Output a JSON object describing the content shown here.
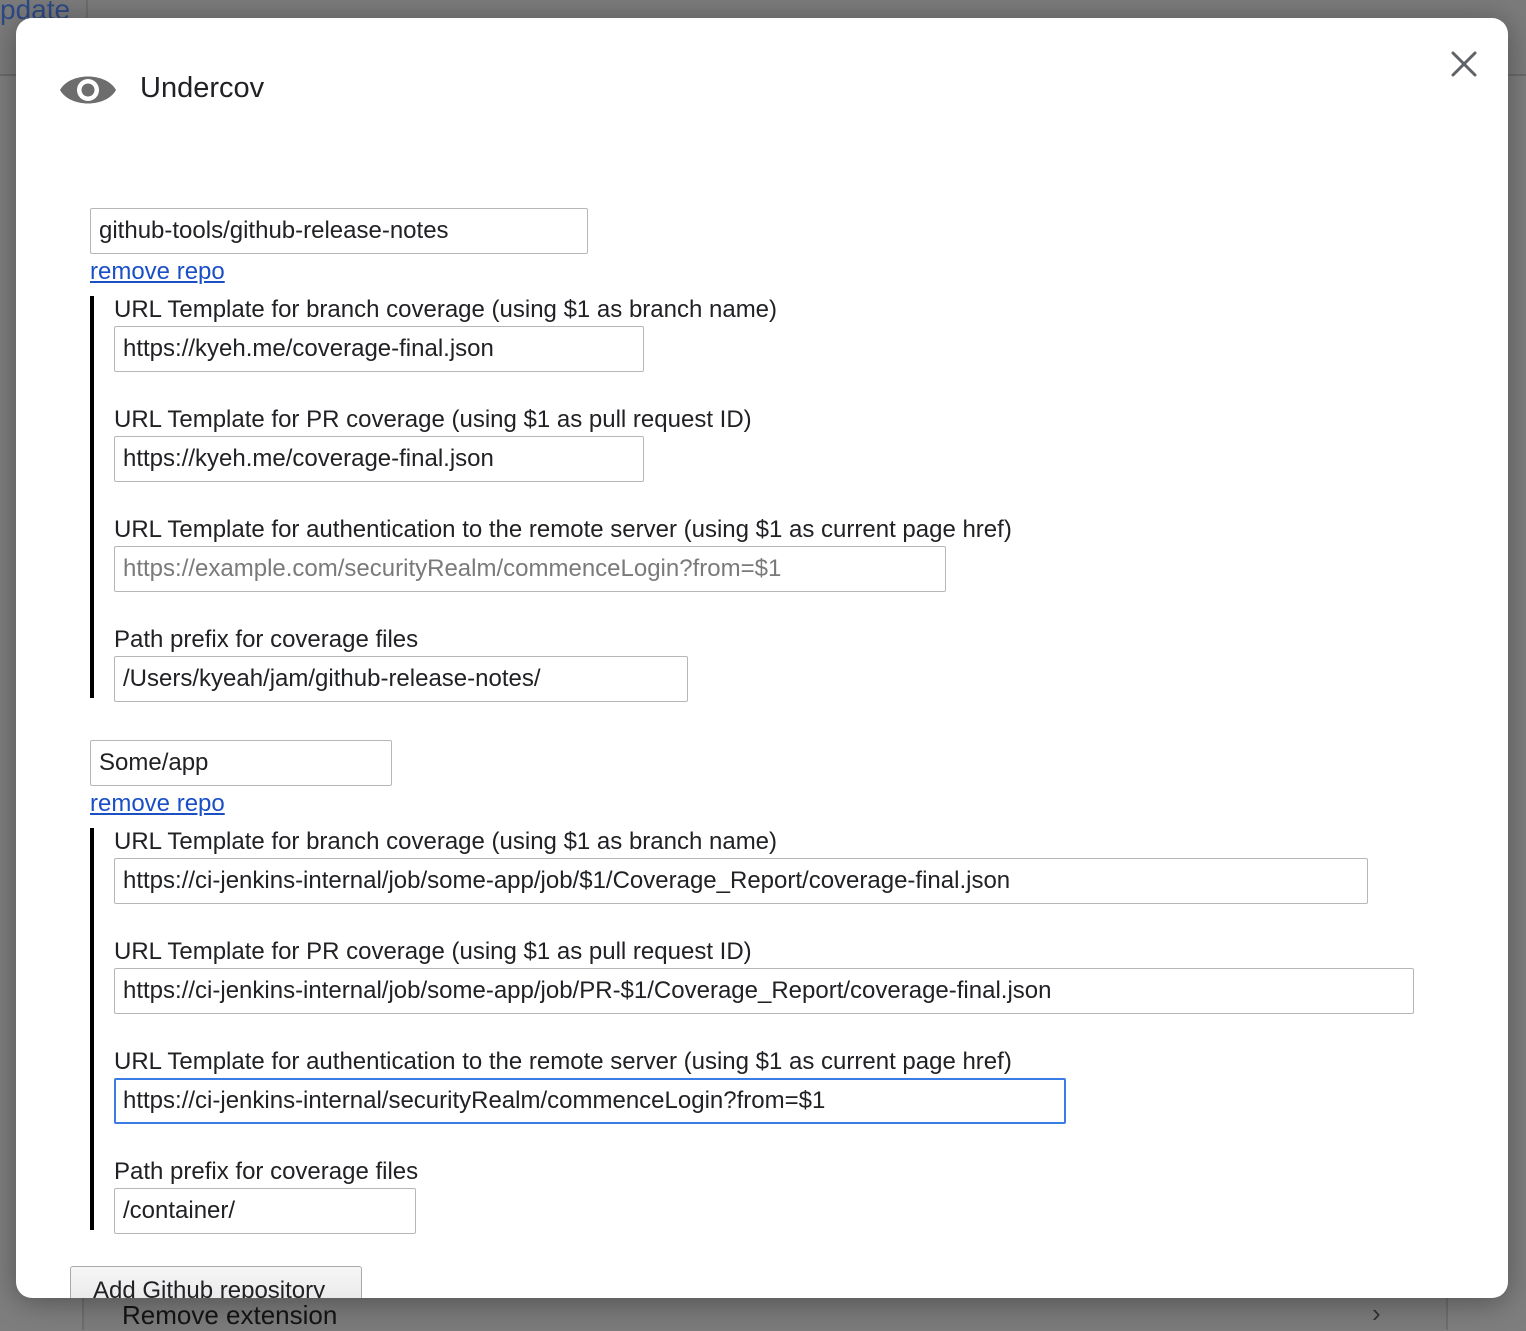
{
  "background": {
    "topbar_text": "pdate",
    "remove_extension_label": "Remove extension",
    "chevron": "›"
  },
  "dialog": {
    "title": "Undercov",
    "icon": "eye-icon",
    "close_icon": "close-icon"
  },
  "repos": [
    {
      "name": "github-tools/github-release-notes",
      "remove_label": "remove repo",
      "fields": [
        {
          "label": "URL Template for branch coverage (using $1 as branch name)",
          "value": "https://kyeh.me/coverage-final.json",
          "placeholder": ""
        },
        {
          "label": "URL Template for PR coverage (using $1 as pull request ID)",
          "value": "https://kyeh.me/coverage-final.json",
          "placeholder": ""
        },
        {
          "label": "URL Template for authentication to the remote server (using $1 as current page href)",
          "value": "",
          "placeholder": "https://example.com/securityRealm/commenceLogin?from=$1"
        },
        {
          "label": "Path prefix for coverage files",
          "value": "/Users/kyeah/jam/github-release-notes/",
          "placeholder": ""
        }
      ]
    },
    {
      "name": "Some/app",
      "remove_label": "remove repo",
      "fields": [
        {
          "label": "URL Template for branch coverage (using $1 as branch name)",
          "value": "https://ci-jenkins-internal/job/some-app/job/$1/Coverage_Report/coverage-final.json",
          "placeholder": ""
        },
        {
          "label": "URL Template for PR coverage (using $1 as pull request ID)",
          "value": "https://ci-jenkins-internal/job/some-app/job/PR-$1/Coverage_Report/coverage-final.json",
          "placeholder": ""
        },
        {
          "label": "URL Template for authentication to the remote server (using $1 as current page href)",
          "value": "https://ci-jenkins-internal/securityRealm/commenceLogin?from=$1",
          "placeholder": ""
        },
        {
          "label": "Path prefix for coverage files",
          "value": "/container/",
          "placeholder": ""
        }
      ]
    }
  ],
  "add_repo_label": "Add Github repository",
  "colors": {
    "link": "#1a4fc6",
    "focus_border": "#3b7ce4",
    "overlay": "#7e7e7e"
  }
}
